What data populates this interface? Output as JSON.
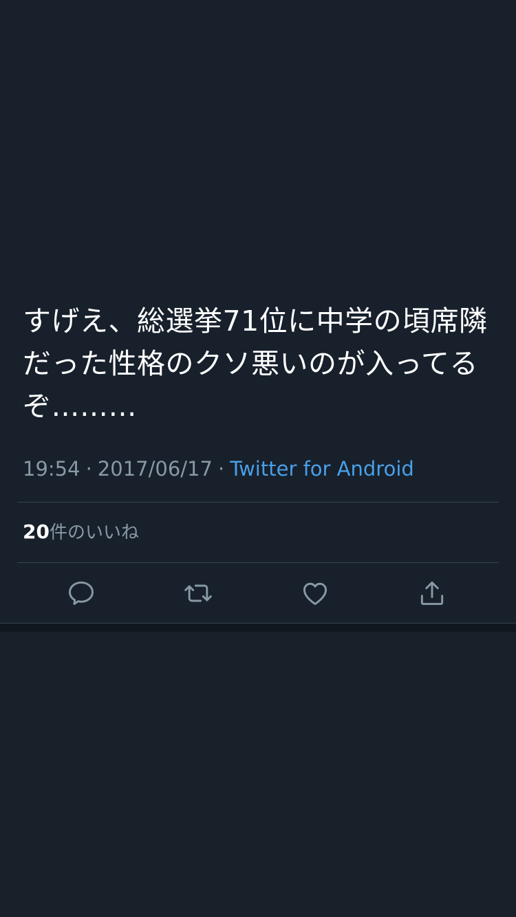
{
  "tweet": {
    "text": "すげえ、総選挙71位に中学の頃席隣だった性格のクソ悪いのが入ってるぞ………",
    "time": "19:54",
    "separator": "·",
    "date": "2017/06/17",
    "source": "Twitter for Android"
  },
  "likes": {
    "count": "20",
    "label": "件のいいね"
  },
  "actions": {
    "reply_icon": "reply-icon",
    "retweet_icon": "retweet-icon",
    "like_icon": "heart-icon",
    "share_icon": "share-icon"
  },
  "colors": {
    "background": "#17202b",
    "text_primary": "#ffffff",
    "text_secondary": "#8899a6",
    "link": "#4a9fe8",
    "divider": "#38444d"
  }
}
